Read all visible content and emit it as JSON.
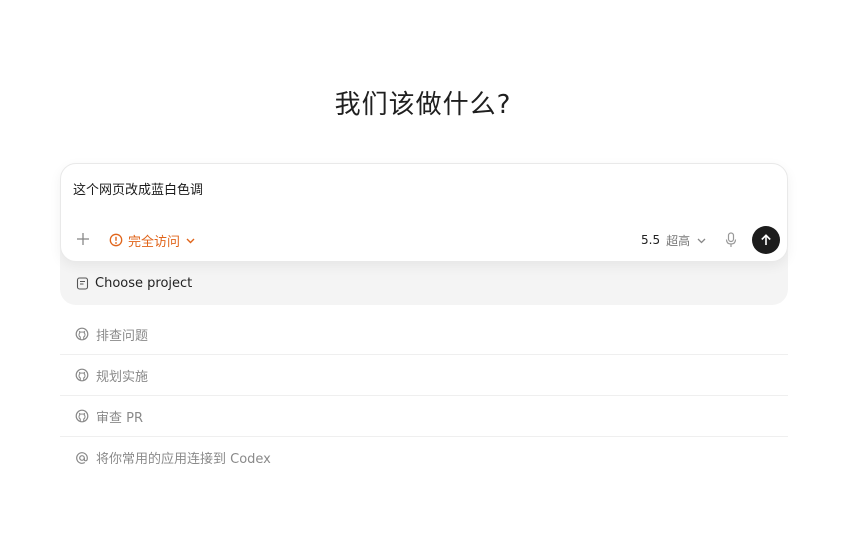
{
  "heading": "我们该做什么?",
  "composer": {
    "text": "这个网页改成蓝白色调",
    "access_label": "完全访问",
    "model_version": "5.5",
    "model_effort": "超高",
    "colors": {
      "access": "#e0641a",
      "send_bg": "#1c1c1c"
    }
  },
  "project": {
    "label": "Choose project"
  },
  "suggestions": [
    {
      "icon": "github-icon",
      "label": "排查问题"
    },
    {
      "icon": "github-icon",
      "label": "规划实施"
    },
    {
      "icon": "github-icon",
      "label": "审查 PR"
    },
    {
      "icon": "at-icon",
      "label": "将你常用的应用连接到 Codex"
    }
  ]
}
